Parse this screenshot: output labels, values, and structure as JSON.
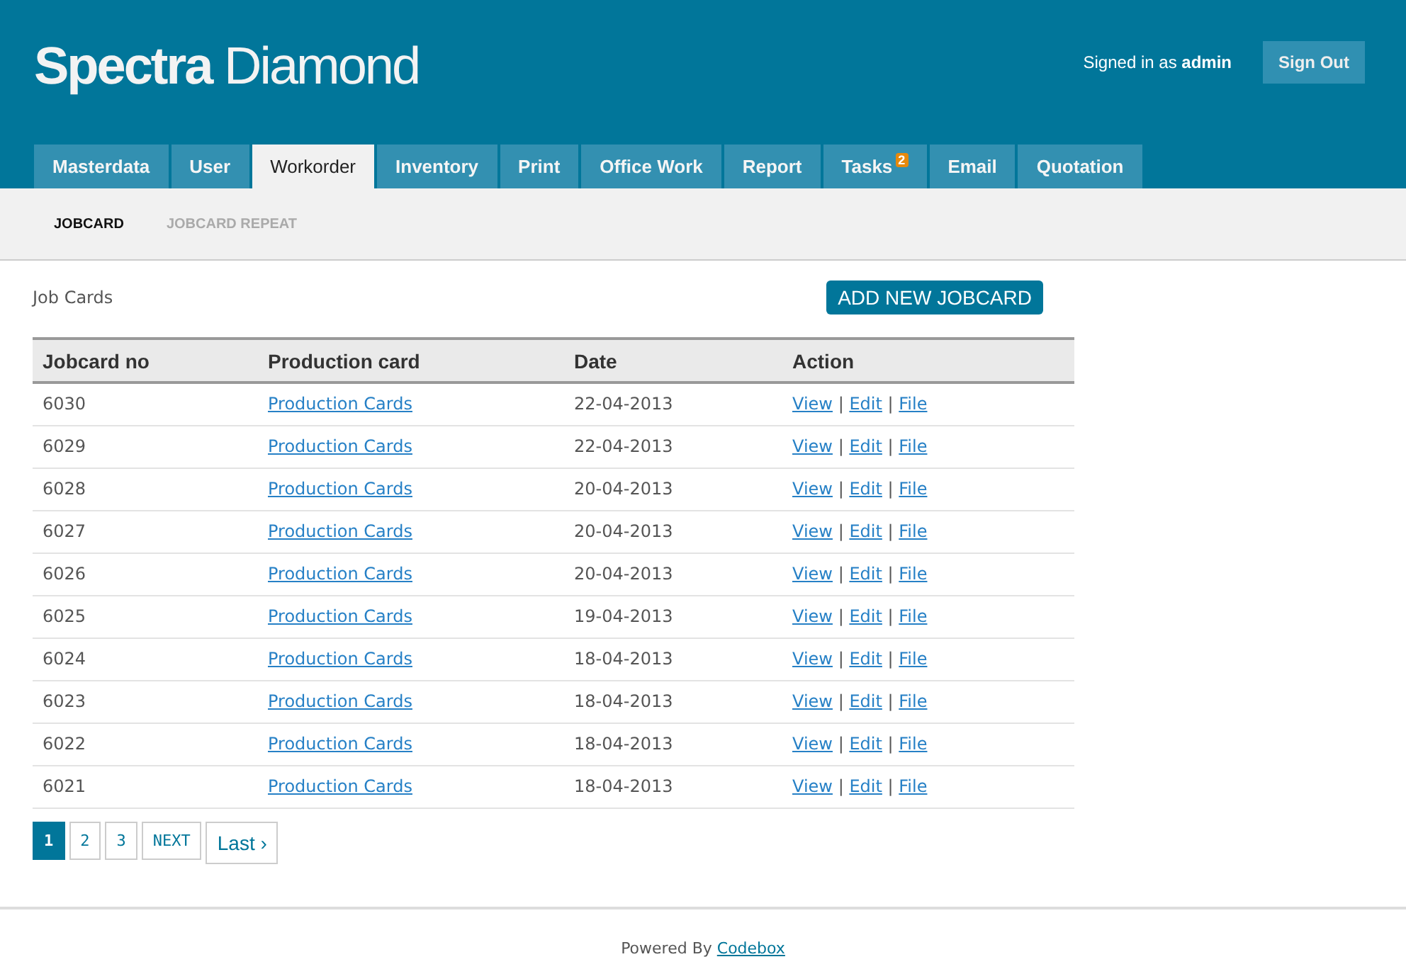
{
  "logo": "**Spectra** Diamond",
  "signed_in": "Signed in as **admin**",
  "sign_out": "Sign Out",
  "tabs": [
    {
      "label": "Masterdata",
      "selected": false
    },
    {
      "label": "User",
      "selected": false
    },
    {
      "label": "Workorder",
      "selected": true
    },
    {
      "label": "Inventory",
      "selected": false
    },
    {
      "label": "Print",
      "selected": false
    },
    {
      "label": "Office Work",
      "selected": false
    },
    {
      "label": "Report",
      "selected": false
    },
    {
      "label": "Tasks",
      "selected": false,
      "badge": "2"
    },
    {
      "label": "Email",
      "selected": false
    },
    {
      "label": "Quotation",
      "selected": false
    }
  ],
  "subtabs": [
    {
      "label": "JOBCARD",
      "selected": true
    },
    {
      "label": "JOBCARD REPEAT",
      "selected": false
    }
  ],
  "page_title": "Job Cards",
  "add_button": "ADD NEW JOBCARD",
  "table": {
    "columns": [
      "Jobcard no",
      "Production card",
      "Date",
      "Action"
    ],
    "separator": "|",
    "rows": [
      {
        "no": "6030",
        "card": "Production Cards",
        "date": "22-04-2013",
        "actions": [
          "View",
          "Edit",
          "File"
        ]
      },
      {
        "no": "6029",
        "card": "Production Cards",
        "date": "22-04-2013",
        "actions": [
          "View",
          "Edit",
          "File"
        ]
      },
      {
        "no": "6028",
        "card": "Production Cards",
        "date": "20-04-2013",
        "actions": [
          "View",
          "Edit",
          "File"
        ]
      },
      {
        "no": "6027",
        "card": "Production Cards",
        "date": "20-04-2013",
        "actions": [
          "View",
          "Edit",
          "File"
        ]
      },
      {
        "no": "6026",
        "card": "Production Cards",
        "date": "20-04-2013",
        "actions": [
          "View",
          "Edit",
          "File"
        ]
      },
      {
        "no": "6025",
        "card": "Production Cards",
        "date": "19-04-2013",
        "actions": [
          "View",
          "Edit",
          "File"
        ]
      },
      {
        "no": "6024",
        "card": "Production Cards",
        "date": "18-04-2013",
        "actions": [
          "View",
          "Edit",
          "File"
        ]
      },
      {
        "no": "6023",
        "card": "Production Cards",
        "date": "18-04-2013",
        "actions": [
          "View",
          "Edit",
          "File"
        ]
      },
      {
        "no": "6022",
        "card": "Production Cards",
        "date": "18-04-2013",
        "actions": [
          "View",
          "Edit",
          "File"
        ]
      },
      {
        "no": "6021",
        "card": "Production Cards",
        "date": "18-04-2013",
        "actions": [
          "View",
          "Edit",
          "File"
        ]
      }
    ]
  },
  "pagination": [
    {
      "label": "1",
      "selected": true,
      "kind": "page"
    },
    {
      "label": "2",
      "selected": false,
      "kind": "page"
    },
    {
      "label": "3",
      "selected": false,
      "kind": "page"
    },
    {
      "label": "NEXT",
      "selected": false,
      "kind": "page"
    },
    {
      "label": "Last ›",
      "selected": false,
      "kind": "last"
    }
  ],
  "footer": {
    "text": "Powered By",
    "link": "Codebox"
  }
}
